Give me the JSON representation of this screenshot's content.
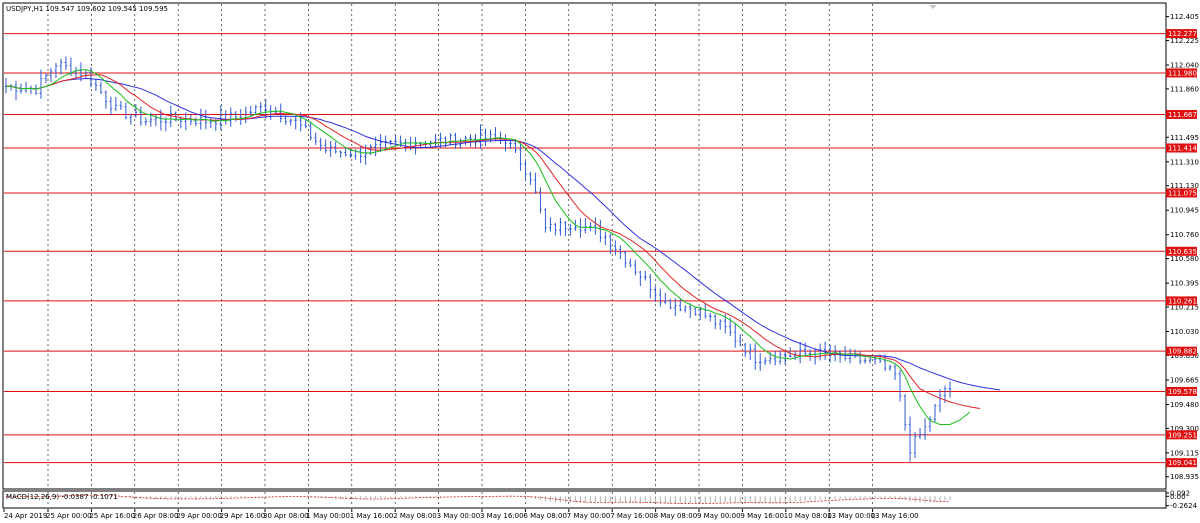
{
  "window": {
    "info": "USDJPY,H1  109.547 109.602 109.545 109.595",
    "macd_label": "MACD(12,26,9) -0.0387 -0.1071"
  },
  "colors": {
    "background": "#ffffff",
    "grid": "#000000",
    "candles": "#2f5bd3",
    "ma_green": "#18c018",
    "ma_red": "#e02424",
    "ma_blue": "#3030e0",
    "levels": "#e01010",
    "macd_hist": "#b0b0b0",
    "macd_signal": "#d02020"
  },
  "chart_data": [
    {
      "type": "candlestick",
      "title": "USDJPY,H1",
      "ylim": [
        108.85,
        112.5
      ],
      "y_ticks": [
        {
          "value": 112.405,
          "label": "112.405"
        },
        {
          "value": 112.225,
          "label": "112.225"
        },
        {
          "value": 112.04,
          "label": "112.040"
        },
        {
          "value": 111.86,
          "label": "111.860"
        },
        {
          "value": 111.495,
          "label": "111.495"
        },
        {
          "value": 111.31,
          "label": "111.310"
        },
        {
          "value": 111.13,
          "label": "111.130"
        },
        {
          "value": 110.945,
          "label": "110.945"
        },
        {
          "value": 110.76,
          "label": "110.760"
        },
        {
          "value": 110.58,
          "label": "110.580"
        },
        {
          "value": 110.395,
          "label": "110.395"
        },
        {
          "value": 110.215,
          "label": "110.215"
        },
        {
          "value": 110.03,
          "label": "110.030"
        },
        {
          "value": 109.85,
          "label": "109.850"
        },
        {
          "value": 109.665,
          "label": "109.665"
        },
        {
          "value": 109.48,
          "label": "109.480"
        },
        {
          "value": 109.3,
          "label": "109.300"
        },
        {
          "value": 109.115,
          "label": "109.115"
        },
        {
          "value": 108.935,
          "label": "108.935"
        }
      ],
      "levels": [
        {
          "value": 112.277,
          "label": "112.277"
        },
        {
          "value": 111.98,
          "label": "111.980"
        },
        {
          "value": 111.667,
          "label": "111.667"
        },
        {
          "value": 111.414,
          "label": "111.414"
        },
        {
          "value": 111.075,
          "label": "111.075"
        },
        {
          "value": 110.635,
          "label": "110.635"
        },
        {
          "value": 110.261,
          "label": "110.261"
        },
        {
          "value": 109.882,
          "label": "109.882"
        },
        {
          "value": 109.578,
          "label": "109.578"
        },
        {
          "value": 109.251,
          "label": "109.251"
        },
        {
          "value": 109.041,
          "label": "109.041"
        }
      ],
      "x_labels": [
        "24 Apr 2019",
        "25 Apr 00:00",
        "25 Apr 16:00",
        "26 Apr 08:00",
        "29 Apr 00:00",
        "29 Apr 16:00",
        "30 Apr 08:00",
        "1 May 00:00",
        "1 May 16:00",
        "2 May 08:00",
        "3 May 00:00",
        "3 May 16:00",
        "6 May 08:00",
        "7 May 00:00",
        "7 May 16:00",
        "8 May 08:00",
        "9 May 00:00",
        "9 May 16:00",
        "10 May 08:00",
        "13 May 00:00",
        "13 May 16:00"
      ],
      "bar_count": 190,
      "price_anchors": [
        [
          0,
          111.88
        ],
        [
          6,
          111.86
        ],
        [
          10,
          112.05
        ],
        [
          16,
          111.97
        ],
        [
          22,
          111.7
        ],
        [
          28,
          111.62
        ],
        [
          34,
          111.64
        ],
        [
          40,
          111.62
        ],
        [
          46,
          111.65
        ],
        [
          52,
          111.73
        ],
        [
          58,
          111.61
        ],
        [
          64,
          111.4
        ],
        [
          70,
          111.37
        ],
        [
          76,
          111.43
        ],
        [
          82,
          111.46
        ],
        [
          88,
          111.47
        ],
        [
          94,
          111.49
        ],
        [
          100,
          111.48
        ],
        [
          105,
          111.2
        ],
        [
          108,
          110.8
        ],
        [
          114,
          110.85
        ],
        [
          120,
          110.75
        ],
        [
          126,
          110.5
        ],
        [
          132,
          110.25
        ],
        [
          138,
          110.2
        ],
        [
          144,
          110.05
        ],
        [
          150,
          109.83
        ],
        [
          156,
          109.85
        ],
        [
          162,
          109.87
        ],
        [
          168,
          109.83
        ],
        [
          174,
          109.8
        ],
        [
          178,
          109.7
        ],
        [
          181,
          109.15
        ],
        [
          184,
          109.3
        ],
        [
          188,
          109.6
        ],
        [
          189,
          109.595
        ]
      ],
      "ma_periods": {
        "green": 8,
        "red": 13,
        "blue": 21
      }
    },
    {
      "type": "macd",
      "title": "MACD(12,26,9)",
      "values": {
        "main": -0.0387,
        "signal": -0.1071
      },
      "ylim": [
        -0.3,
        0.12
      ],
      "y_ticks": [
        {
          "value": 0.092,
          "label": "0.092"
        },
        {
          "value": 0.0,
          "label": "0.00"
        },
        {
          "value": -0.2624,
          "label": "-0.2624"
        }
      ]
    }
  ]
}
